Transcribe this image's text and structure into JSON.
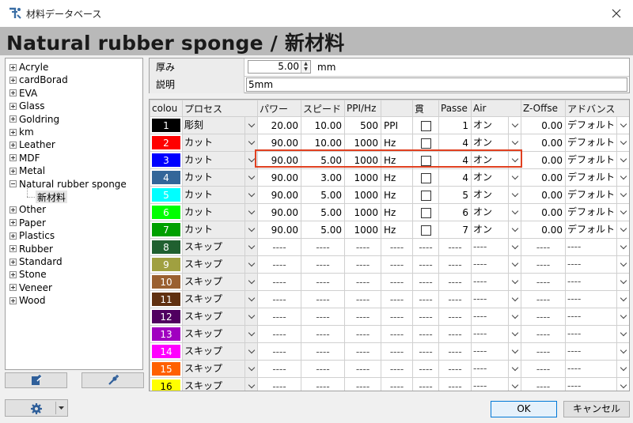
{
  "window": {
    "title": "材料データベース"
  },
  "header": {
    "title": "Natural rubber sponge / 新材料"
  },
  "tree": {
    "items": [
      "Acryle",
      "cardBorad",
      "EVA",
      "Glass",
      "Goldring",
      "km",
      "Leather",
      "MDF",
      "Metal",
      "Natural rubber sponge",
      "Other",
      "Paper",
      "Plastics",
      "Rubber",
      "Standard",
      "Stone",
      "Veneer",
      "Wood"
    ],
    "expanded_index": 9,
    "child": "新材料"
  },
  "properties": {
    "thickness_label": "厚み",
    "thickness_value": "5.00",
    "thickness_unit": "mm",
    "description_label": "説明",
    "description_value": "5mm"
  },
  "grid": {
    "headers": [
      "colou",
      "プロセス",
      "パワー",
      "スピード",
      "PPI/Hz",
      "",
      "貫",
      "Passe",
      "Air",
      "Z-Offse",
      "アドバンス"
    ],
    "rows": [
      {
        "num": "1",
        "color": "#000000",
        "text": "#ffffff",
        "process": "彫刻",
        "power": "20.00",
        "speed": "10.00",
        "freq": "500",
        "unit": "PPI",
        "passes": "1",
        "air": "オン",
        "zoffset": "0.00",
        "advance": "デフォルト"
      },
      {
        "num": "2",
        "color": "#ff0000",
        "text": "#ffffff",
        "process": "カット",
        "power": "90.00",
        "speed": "10.00",
        "freq": "1000",
        "unit": "Hz",
        "passes": "4",
        "air": "オン",
        "zoffset": "0.00",
        "advance": "デフォルト"
      },
      {
        "num": "3",
        "color": "#0000ff",
        "text": "#ffffff",
        "process": "カット",
        "power": "90.00",
        "speed": "5.00",
        "freq": "1000",
        "unit": "Hz",
        "passes": "4",
        "air": "オン",
        "zoffset": "0.00",
        "advance": "デフォルト"
      },
      {
        "num": "4",
        "color": "#336699",
        "text": "#ffffff",
        "process": "カット",
        "power": "90.00",
        "speed": "3.00",
        "freq": "1000",
        "unit": "Hz",
        "passes": "4",
        "air": "オン",
        "zoffset": "0.00",
        "advance": "デフォルト"
      },
      {
        "num": "5",
        "color": "#00ffff",
        "text": "#ffffff",
        "process": "カット",
        "power": "90.00",
        "speed": "5.00",
        "freq": "1000",
        "unit": "Hz",
        "passes": "5",
        "air": "オン",
        "zoffset": "0.00",
        "advance": "デフォルト"
      },
      {
        "num": "6",
        "color": "#00ff00",
        "text": "#ffffff",
        "process": "カット",
        "power": "90.00",
        "speed": "5.00",
        "freq": "1000",
        "unit": "Hz",
        "passes": "6",
        "air": "オン",
        "zoffset": "0.00",
        "advance": "デフォルト"
      },
      {
        "num": "7",
        "color": "#00a000",
        "text": "#ffffff",
        "process": "カット",
        "power": "90.00",
        "speed": "5.00",
        "freq": "1000",
        "unit": "Hz",
        "passes": "7",
        "air": "オン",
        "zoffset": "0.00",
        "advance": "デフォルト"
      },
      {
        "num": "8",
        "color": "#206030",
        "text": "#ffffff",
        "process": "スキップ",
        "dash": "----"
      },
      {
        "num": "9",
        "color": "#a0a040",
        "text": "#ffffff",
        "process": "スキップ",
        "dash": "----"
      },
      {
        "num": "10",
        "color": "#9a6030",
        "text": "#ffffff",
        "process": "スキップ",
        "dash": "----"
      },
      {
        "num": "11",
        "color": "#603010",
        "text": "#ffffff",
        "process": "スキップ",
        "dash": "----"
      },
      {
        "num": "12",
        "color": "#500060",
        "text": "#ffffff",
        "process": "スキップ",
        "dash": "----"
      },
      {
        "num": "13",
        "color": "#a000c0",
        "text": "#ffffff",
        "process": "スキップ",
        "dash": "----"
      },
      {
        "num": "14",
        "color": "#ff00ff",
        "text": "#ffffff",
        "process": "スキップ",
        "dash": "----"
      },
      {
        "num": "15",
        "color": "#ff6000",
        "text": "#ffffff",
        "process": "スキップ",
        "dash": "----"
      },
      {
        "num": "16",
        "color": "#ffff00",
        "text": "#000000",
        "process": "スキップ",
        "dash": "----"
      }
    ]
  },
  "buttons": {
    "ok": "OK",
    "cancel": "キャンセル"
  },
  "icons": {
    "app": "app-logo-icon",
    "close": "close-icon",
    "add_material": "add-material-icon",
    "add_layer": "add-layer-icon",
    "settings": "gear-icon"
  },
  "colors": {
    "highlight": "#e04020",
    "header_band": "#b9b9b9"
  }
}
